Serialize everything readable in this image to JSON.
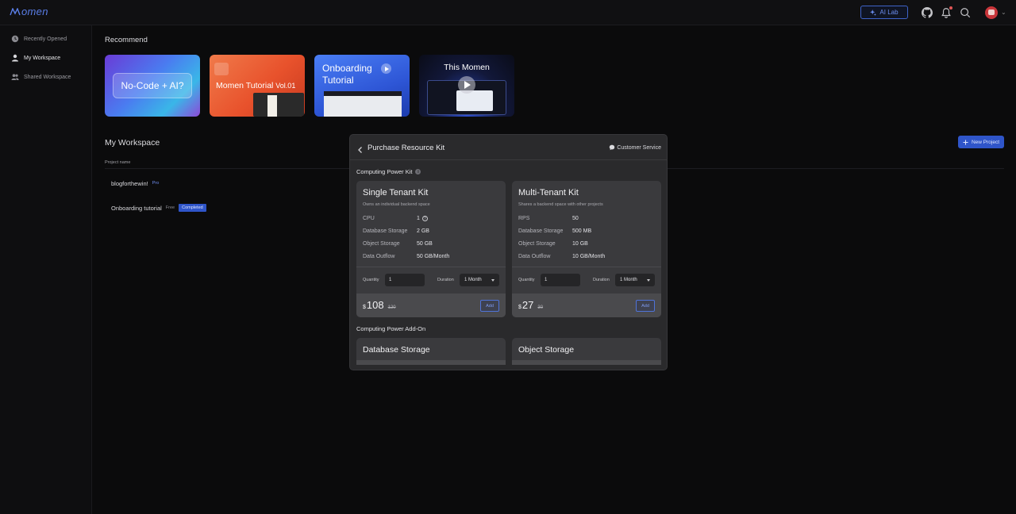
{
  "brand": {
    "logo_text": "omen",
    "accent": "#2f55c9"
  },
  "topbar": {
    "ai_lab_label": "AI Lab",
    "icons": [
      "github-icon",
      "bell-icon",
      "search-icon",
      "avatar",
      "chevron-down-icon"
    ]
  },
  "sidebar": {
    "items": [
      {
        "label": "Recently Opened",
        "icon": "clock-icon"
      },
      {
        "label": "My Workspace",
        "icon": "user-icon",
        "active": true
      },
      {
        "label": "Shared Workspace",
        "icon": "users-icon"
      }
    ]
  },
  "recommend": {
    "title": "Recommend",
    "cards": [
      {
        "title": "No-Code + AI?"
      },
      {
        "title": "Momen Tutorial",
        "suffix": "Vol.01"
      },
      {
        "title_line1": "Onboarding",
        "title_line2": "Tutorial"
      },
      {
        "title": "This Momen"
      }
    ]
  },
  "workspace": {
    "title": "My Workspace",
    "new_project_label": "New Project",
    "column_project_name": "Project name",
    "projects": [
      {
        "name": "blogforthewin!",
        "plan": "Pro"
      },
      {
        "name": "Onboarding tutorial",
        "plan": "Free",
        "status": "Completed"
      }
    ]
  },
  "modal": {
    "title": "Purchase Resource Kit",
    "customer_service": "Customer Service",
    "section_kit": "Computing Power Kit",
    "section_addon": "Computing Power Add-On",
    "kits": [
      {
        "name": "Single Tenant Kit",
        "description": "Owns an individual backend space",
        "specs": [
          {
            "label": "CPU",
            "value": "1"
          },
          {
            "label": "Database Storage",
            "value": "2 GB"
          },
          {
            "label": "Object Storage",
            "value": "50 GB"
          },
          {
            "label": "Data Outflow",
            "value": "50 GB/Month"
          }
        ],
        "quantity_label": "Quantity",
        "quantity": "1",
        "duration_label": "Duration",
        "duration": "1 Month",
        "currency": "$",
        "price": "108",
        "old_price": "120",
        "add_label": "Add"
      },
      {
        "name": "Multi-Tenant Kit",
        "description": "Shares a backend space with other projects",
        "specs": [
          {
            "label": "RPS",
            "value": "50"
          },
          {
            "label": "Database Storage",
            "value": "500 MB"
          },
          {
            "label": "Object Storage",
            "value": "10 GB"
          },
          {
            "label": "Data Outflow",
            "value": "10 GB/Month"
          }
        ],
        "quantity_label": "Quantity",
        "quantity": "1",
        "duration_label": "Duration",
        "duration": "1 Month",
        "currency": "$",
        "price": "27",
        "old_price": "30",
        "add_label": "Add"
      }
    ],
    "addons": [
      {
        "name": "Database Storage"
      },
      {
        "name": "Object Storage"
      }
    ]
  }
}
